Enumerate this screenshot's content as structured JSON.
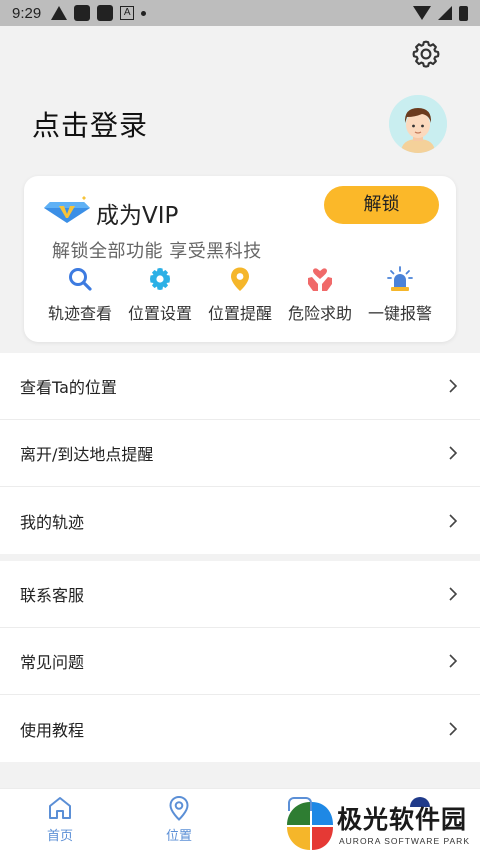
{
  "status_bar": {
    "time": "9:29"
  },
  "header": {
    "login_text": "点击登录"
  },
  "vip": {
    "title": "成为VIP",
    "unlock_label": "解锁",
    "subtitle": "解锁全部功能 享受黑科技",
    "features": [
      {
        "label": "轨迹查看",
        "icon": "search-icon",
        "color": "#3d7be0"
      },
      {
        "label": "位置设置",
        "icon": "gear-icon",
        "color": "#2bb0e6"
      },
      {
        "label": "位置提醒",
        "icon": "location-pin-icon",
        "color": "#f5b62a"
      },
      {
        "label": "危险求助",
        "icon": "helping-hands-icon",
        "color": "#f06a6a"
      },
      {
        "label": "一键报警",
        "icon": "alarm-light-icon",
        "color": "#4a82d8"
      }
    ]
  },
  "menu_group_1": [
    {
      "label": "查看Ta的位置"
    },
    {
      "label": "离开/到达地点提醒"
    },
    {
      "label": "我的轨迹"
    }
  ],
  "menu_group_2": [
    {
      "label": "联系客服"
    },
    {
      "label": "常见问题"
    },
    {
      "label": "使用教程"
    }
  ],
  "bottom_nav": [
    {
      "label": "首页",
      "icon": "home-icon"
    },
    {
      "label": "位置",
      "icon": "location-icon"
    }
  ],
  "watermark": {
    "title": "极光软件园",
    "subtitle": "AURORA SOFTWARE PARK"
  },
  "colors": {
    "accent": "#fbb829",
    "nav": "#5b8fd6",
    "background": "#f2f2f2"
  }
}
